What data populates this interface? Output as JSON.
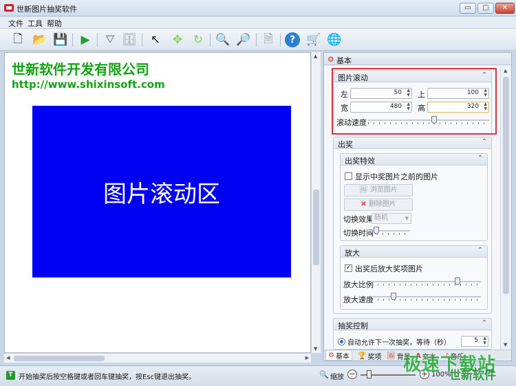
{
  "window": {
    "title": "世新图片抽奖软件",
    "minimize": "▭",
    "maximize": "□",
    "close": "✕"
  },
  "menu": [
    "文件",
    "工具",
    "帮助"
  ],
  "toolbar": [
    {
      "name": "new-icon",
      "glyph": "🗋"
    },
    {
      "name": "open-icon",
      "glyph": "📂"
    },
    {
      "name": "save-icon",
      "glyph": "💾"
    },
    {
      "name": "play-icon",
      "glyph": "▶"
    },
    {
      "name": "filter-icon",
      "glyph": "⛛"
    },
    {
      "name": "database-icon",
      "glyph": "🗄"
    },
    {
      "name": "pointer-icon",
      "glyph": "↖"
    },
    {
      "name": "move-icon",
      "glyph": "✥"
    },
    {
      "name": "refresh-icon",
      "glyph": "↻"
    },
    {
      "name": "zoom-in-icon",
      "glyph": "🔍"
    },
    {
      "name": "zoom-out-icon",
      "glyph": "🔎"
    },
    {
      "name": "page-icon",
      "glyph": "🗎"
    },
    {
      "name": "help-icon",
      "glyph": "?"
    },
    {
      "name": "cart-icon",
      "glyph": "🛒"
    },
    {
      "name": "globe-icon",
      "glyph": "🌐"
    }
  ],
  "canvas": {
    "company": "世新软件开发有限公司",
    "url": "http://www.shixinsoft.com",
    "scroll_area_text": "图片滚动区",
    "scroll_area_color": "#0000f2",
    "brand_green": "#12a312"
  },
  "panel": {
    "header": "基本",
    "image_scroll": {
      "title": "图片滚动",
      "left_label": "左",
      "left_value": "50",
      "top_label": "上",
      "top_value": "100",
      "width_label": "宽",
      "width_value": "480",
      "height_label": "高",
      "height_value": "320",
      "speed_label": "滚动速度",
      "speed_level": 0.55
    },
    "prize": {
      "title": "出奖",
      "effects": {
        "title": "出奖特效",
        "show_previous": "显示中奖图片之前的图片",
        "show_previous_checked": false,
        "browse_button": "浏览图片",
        "delete_button": "删除图片",
        "switch_effect_label": "切换效果",
        "switch_effect_value": "随机",
        "switch_time_label": "切换时间",
        "switch_time_level": 0.06
      },
      "enlarge": {
        "title": "放大",
        "enlarge_checkbox": "出奖后放大奖项图片",
        "enlarge_checked": true,
        "ratio_label": "放大比例",
        "ratio_level": 0.8,
        "speed_label": "放大速度",
        "speed_level": 0.18
      }
    },
    "draw_control": {
      "title": "抽奖控制",
      "auto_label": "自动允许下一次抽奖，等待（秒）",
      "auto_value": "5"
    },
    "tabs": [
      {
        "label": "基本",
        "icon": "gear-icon",
        "glyph": "⚙"
      },
      {
        "label": "奖项",
        "icon": "prize-icon",
        "glyph": "🏆"
      },
      {
        "label": "背景",
        "icon": "image-icon",
        "glyph": "🖼"
      },
      {
        "label": "文本",
        "icon": "text-icon",
        "glyph": "A"
      },
      {
        "label": "音乐",
        "icon": "music-icon",
        "glyph": "♪"
      }
    ]
  },
  "status": {
    "text": "开始抽奖后按空格键或者回车键抽奖，按Esc键退出抽奖。",
    "zoom_label": "缩放",
    "zoom_value": "100%",
    "zoom_level": 0.12
  },
  "watermark": {
    "line1": "极速下载站",
    "line2": "世新软件"
  }
}
